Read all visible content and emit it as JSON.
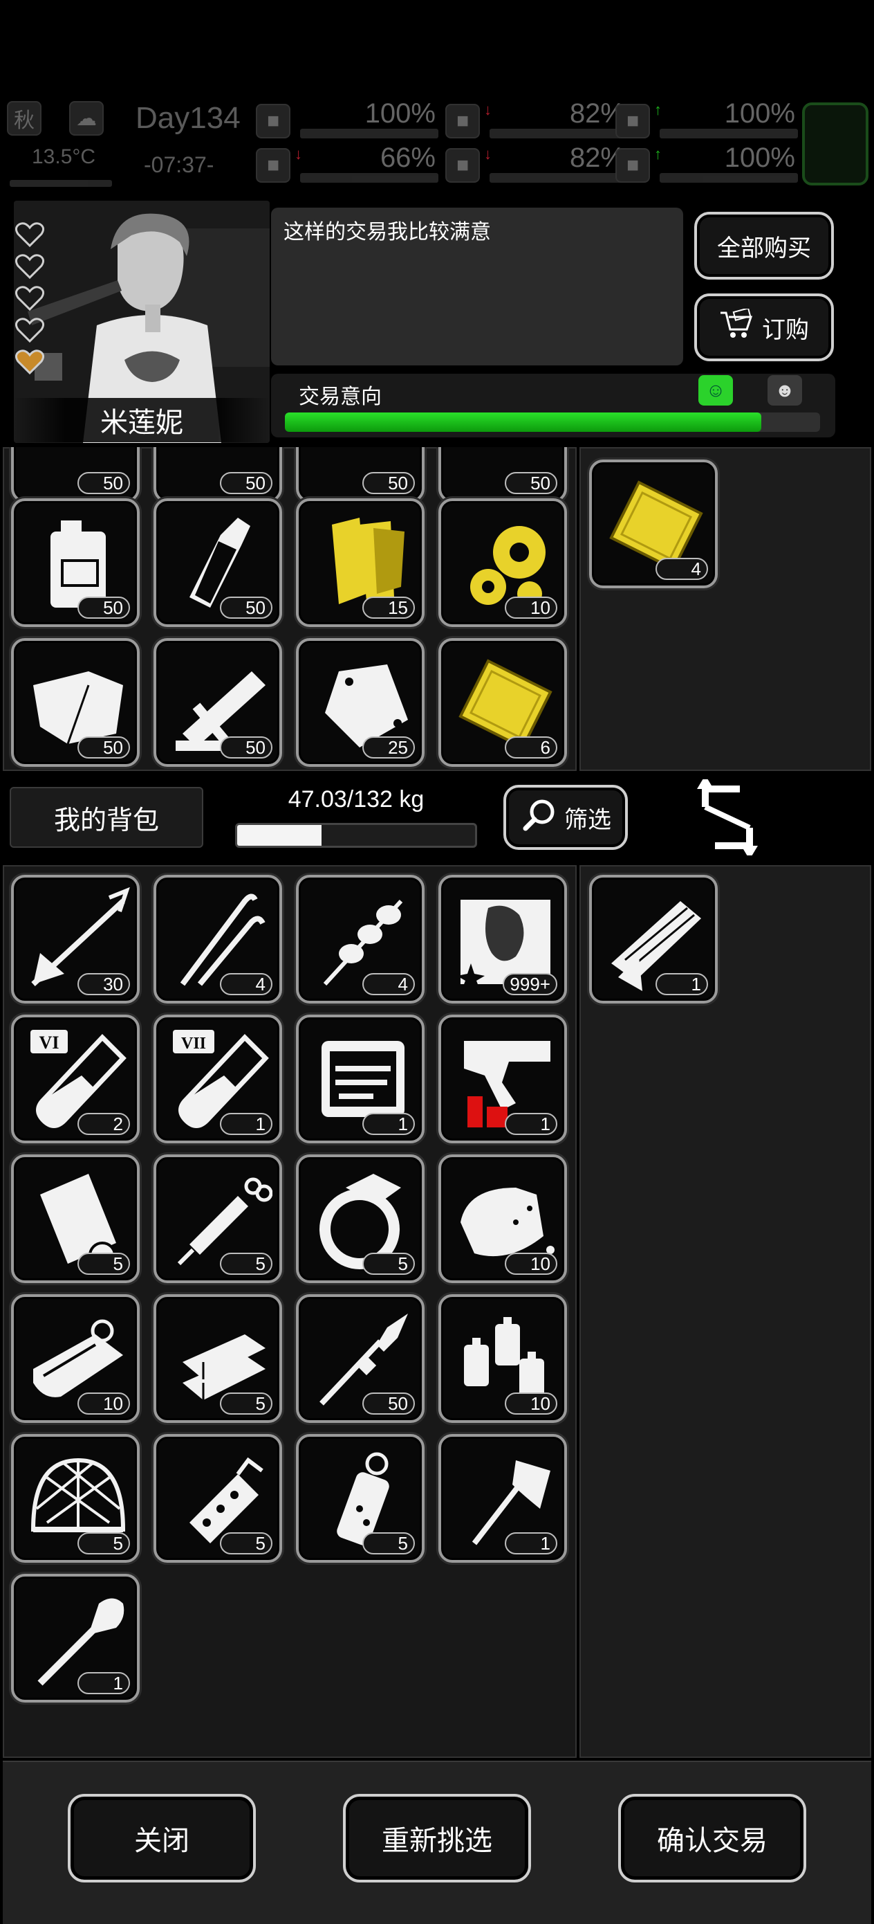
{
  "status": {
    "season": "秋",
    "temperature": "13.5°C",
    "day": "Day134",
    "time": "-07:37-",
    "stats": [
      {
        "icon": "medkit-icon",
        "pct": "100%",
        "value": 1.0,
        "arrow": "",
        "arrow_color": ""
      },
      {
        "icon": "stomach-icon",
        "pct": "82%",
        "value": 0.82,
        "arrow": "↓",
        "arrow_color": "#c23"
      },
      {
        "icon": "battery-icon",
        "pct": "100%",
        "value": 1.0,
        "arrow": "↑",
        "arrow_color": "#2c2"
      },
      {
        "icon": "boot-icon",
        "pct": "66%",
        "value": 0.66,
        "arrow": "↓",
        "arrow_color": "#c23"
      },
      {
        "icon": "water-drop-icon",
        "pct": "82%",
        "value": 0.82,
        "arrow": "↓",
        "arrow_color": "#c23"
      },
      {
        "icon": "heart-icon",
        "pct": "100%",
        "value": 1.0,
        "arrow": "↑",
        "arrow_color": "#2c2"
      }
    ]
  },
  "merchant": {
    "name": "米莲妮",
    "dialog": "这样的交易我比较满意",
    "buy_all_label": "全部购买",
    "order_label": "订购",
    "intent_label": "交易意向",
    "intent_value": 0.89,
    "hearts": 5
  },
  "trader_items": [
    {
      "icon": "partial-item-a",
      "count": "50"
    },
    {
      "icon": "partial-item-b",
      "count": "50"
    },
    {
      "icon": "partial-item-c",
      "count": "50"
    },
    {
      "icon": "partial-item-d",
      "count": "50"
    },
    {
      "icon": "jerrycan-icon",
      "count": "50"
    },
    {
      "icon": "bottle-icon",
      "count": "50"
    },
    {
      "icon": "gold-cloth-icon",
      "count": "15"
    },
    {
      "icon": "gold-gears-icon",
      "count": "10"
    },
    {
      "icon": "cloth-icon",
      "count": "50"
    },
    {
      "icon": "wood-planks-icon",
      "count": "50"
    },
    {
      "icon": "plastic-bag-icon",
      "count": "25"
    },
    {
      "icon": "gold-plate-icon",
      "count": "6"
    }
  ],
  "trader_offer": [
    {
      "icon": "gold-plate-icon",
      "count": "4"
    }
  ],
  "inventory": {
    "title": "我的背包",
    "weight": "47.03/132 kg",
    "weight_ratio": 0.356,
    "filter_label": "筛选"
  },
  "my_items": [
    {
      "icon": "arrow-icon",
      "count": "30"
    },
    {
      "icon": "lockpick-icon",
      "count": "4"
    },
    {
      "icon": "skewer-icon",
      "count": "4"
    },
    {
      "icon": "zombie-poster-icon",
      "count": "999+"
    },
    {
      "icon": "test-tube-vi-icon",
      "count": "2",
      "mark": "VI"
    },
    {
      "icon": "test-tube-vii-icon",
      "count": "1",
      "mark": "VII"
    },
    {
      "icon": "toolkit-icon",
      "count": "1"
    },
    {
      "icon": "flare-gun-icon",
      "count": "1"
    },
    {
      "icon": "scroll-icon",
      "count": "5"
    },
    {
      "icon": "syringe-icon",
      "count": "5"
    },
    {
      "icon": "ring-icon",
      "count": "5"
    },
    {
      "icon": "bread-icon",
      "count": "10"
    },
    {
      "icon": "canned-fish-icon",
      "count": "10"
    },
    {
      "icon": "gold-bars-icon",
      "count": "5"
    },
    {
      "icon": "rocket-icon",
      "count": "50"
    },
    {
      "icon": "spray-cans-icon",
      "count": "10"
    },
    {
      "icon": "dome-cage-icon",
      "count": "5"
    },
    {
      "icon": "grenade-icon",
      "count": "5"
    },
    {
      "icon": "stun-grenade-icon",
      "count": "5"
    },
    {
      "icon": "axe-icon",
      "count": "1"
    },
    {
      "icon": "shovel-icon",
      "count": "1"
    }
  ],
  "my_offer": [
    {
      "icon": "minigun-icon",
      "count": "1"
    }
  ],
  "footer": {
    "close_label": "关闭",
    "reselect_label": "重新挑选",
    "confirm_label": "确认交易"
  }
}
